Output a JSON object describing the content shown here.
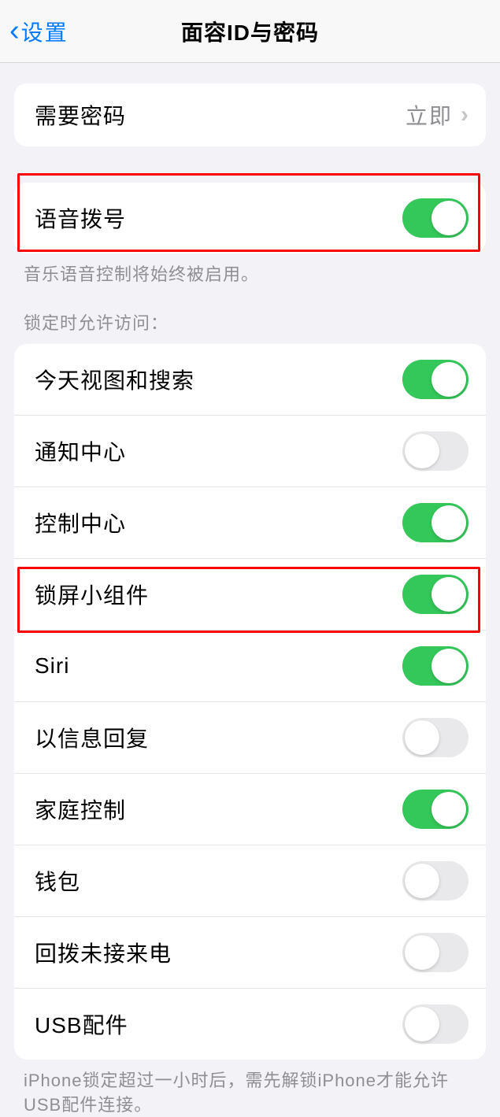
{
  "nav": {
    "back_label": "设置",
    "title": "面容ID与密码"
  },
  "passcode_group": {
    "require_label": "需要密码",
    "require_value": "立即"
  },
  "voice_group": {
    "voice_dial_label": "语音拨号",
    "voice_dial_on": true,
    "footer": "音乐语音控制将始终被启用。"
  },
  "lockscreen": {
    "header": "锁定时允许访问：",
    "items": [
      {
        "label": "今天视图和搜索",
        "on": true
      },
      {
        "label": "通知中心",
        "on": false
      },
      {
        "label": "控制中心",
        "on": true
      },
      {
        "label": "锁屏小组件",
        "on": true
      },
      {
        "label": "Siri",
        "on": true
      },
      {
        "label": "以信息回复",
        "on": false
      },
      {
        "label": "家庭控制",
        "on": true
      },
      {
        "label": "钱包",
        "on": false
      },
      {
        "label": "回拨未接来电",
        "on": false
      },
      {
        "label": "USB配件",
        "on": false
      }
    ],
    "footer": "iPhone锁定超过一小时后，需先解锁iPhone才能允许USB配件连接。"
  }
}
